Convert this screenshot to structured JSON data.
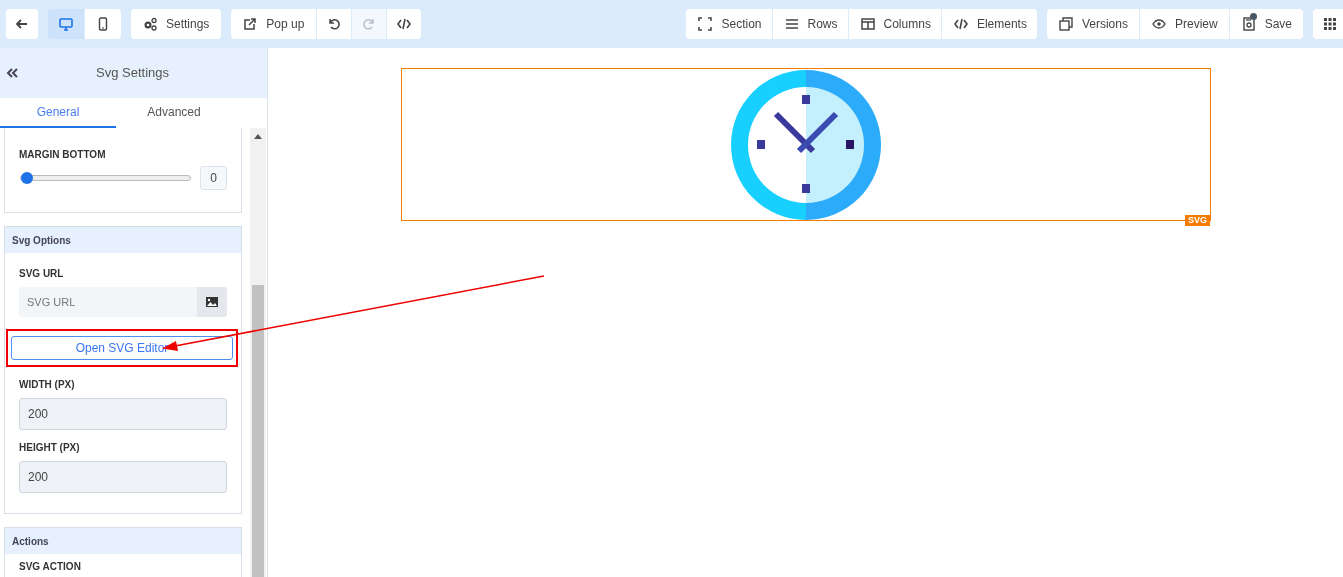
{
  "toolbar": {
    "back": {
      "disabled": false
    },
    "devices": [
      {
        "selected": true
      },
      {
        "selected": false
      }
    ],
    "left_buttons": [
      {
        "label": "Settings",
        "disabled": false
      },
      {
        "label": "Pop up",
        "disabled": false
      },
      {
        "disabled": false
      },
      {
        "disabled": true
      },
      {
        "disabled": false
      }
    ],
    "build_buttons": [
      {
        "label": "Section"
      },
      {
        "label": "Rows"
      },
      {
        "label": "Columns"
      },
      {
        "label": "Elements"
      }
    ],
    "publish_buttons": [
      {
        "label": "Versions",
        "unsaved": false
      },
      {
        "label": "Preview",
        "unsaved": false
      },
      {
        "label": "Save",
        "unsaved": true
      }
    ]
  },
  "sidebar": {
    "title": "Svg Settings",
    "tabs": [
      {
        "label": "General",
        "selected": true
      },
      {
        "label": "Advanced",
        "selected": false
      }
    ],
    "sections": [
      {
        "fields": [
          {
            "kind": "slider",
            "label": "MARGIN BOTTOM",
            "level": 0,
            "value": "0"
          }
        ]
      },
      {
        "title": "Svg Options",
        "fields": [
          {
            "kind": "url",
            "label": "SVG URL",
            "placeholder": "SVG URL"
          },
          {
            "kind": "button",
            "label": "Open SVG Editor",
            "highlighted": true
          },
          {
            "kind": "number",
            "label": "WIDTH (PX)",
            "value": "200"
          },
          {
            "kind": "number",
            "label": "HEIGHT (PX)",
            "value": "200"
          }
        ]
      },
      {
        "title": "Actions",
        "fields": [
          {
            "kind": "label",
            "label": "SVG ACTION"
          }
        ]
      }
    ]
  },
  "canvas": {
    "element": {
      "badge": "SVG",
      "selected": true
    }
  },
  "annotation": {
    "arrow": true
  }
}
